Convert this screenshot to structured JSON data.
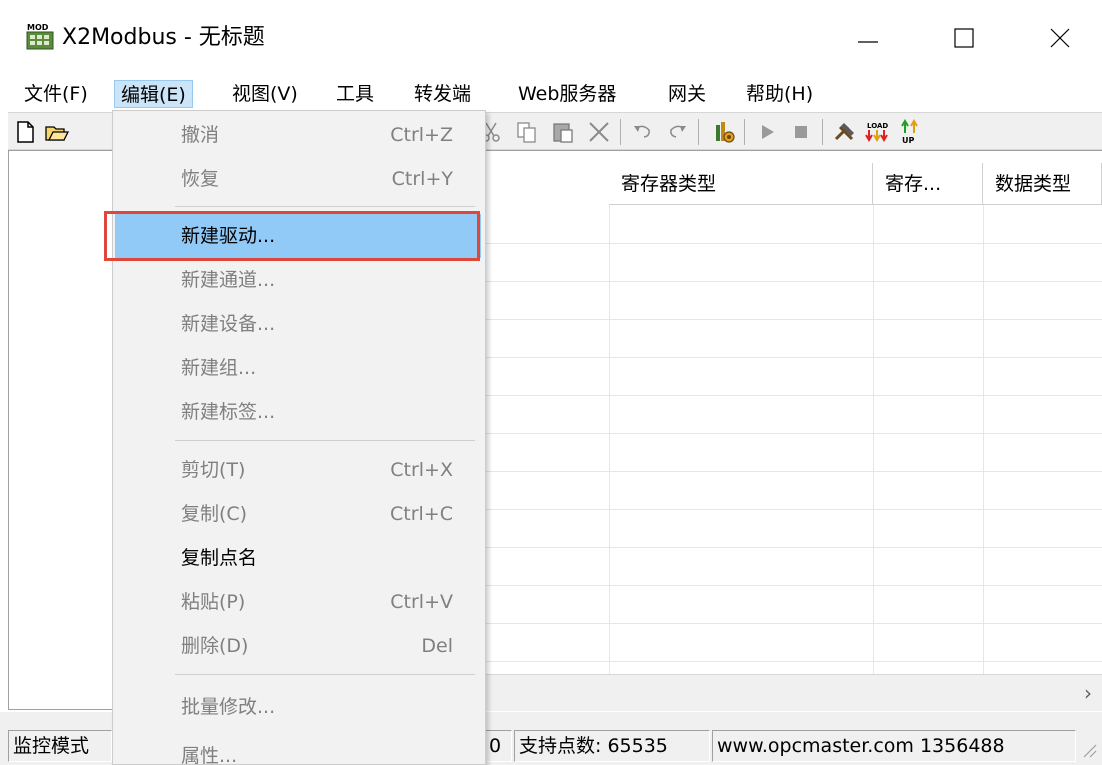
{
  "window": {
    "title": "X2Modbus - 无标题",
    "icon": "mod-app-icon",
    "controls": [
      "minimize-icon",
      "maximize-icon",
      "close-icon"
    ]
  },
  "menubar": {
    "items": [
      {
        "label": "文件(F)"
      },
      {
        "label": "编辑(E)"
      },
      {
        "label": "视图(V)"
      },
      {
        "label": "工具"
      },
      {
        "label": "转发端"
      },
      {
        "label": "Web服务器"
      },
      {
        "label": "网关"
      },
      {
        "label": "帮助(H)"
      }
    ]
  },
  "toolbar": {
    "icons": [
      "new-file-icon",
      "open-folder-icon",
      "cut-icon",
      "copy-icon",
      "paste-icon",
      "delete-icon",
      "undo-icon",
      "redo-icon",
      "driver-icon",
      "run-icon",
      "stop-icon",
      "tools-icon",
      "load-icon",
      "up-icon"
    ]
  },
  "grid": {
    "columns": [
      "寄存器类型",
      "寄存...",
      "数据类型"
    ]
  },
  "edit_menu": {
    "items": [
      {
        "label": "撤消",
        "shortcut": "Ctrl+Z",
        "enabled": false
      },
      {
        "label": "恢复",
        "shortcut": "Ctrl+Y",
        "enabled": false
      },
      {
        "label": "新建驱动...",
        "shortcut": "",
        "enabled": true,
        "highlighted": true
      },
      {
        "label": "新建通道...",
        "shortcut": "",
        "enabled": false
      },
      {
        "label": "新建设备...",
        "shortcut": "",
        "enabled": false
      },
      {
        "label": "新建组...",
        "shortcut": "",
        "enabled": false
      },
      {
        "label": "新建标签...",
        "shortcut": "",
        "enabled": false
      },
      {
        "label": "剪切(T)",
        "shortcut": "Ctrl+X",
        "enabled": false
      },
      {
        "label": "复制(C)",
        "shortcut": "Ctrl+C",
        "enabled": false
      },
      {
        "label": "复制点名",
        "shortcut": "",
        "enabled": true
      },
      {
        "label": "粘贴(P)",
        "shortcut": "Ctrl+V",
        "enabled": false
      },
      {
        "label": "删除(D)",
        "shortcut": "Del",
        "enabled": false
      },
      {
        "label": "批量修改...",
        "shortcut": "",
        "enabled": false
      },
      {
        "label": "属性...",
        "shortcut": "",
        "enabled": false
      }
    ]
  },
  "statusbar": {
    "mode": "监控模式",
    "count": "0",
    "capacity": "支持点数: 65535",
    "site": "www.opcmaster.com 1356488"
  },
  "colors": {
    "highlight": "#91c9f7",
    "highlight_border": "#e0473b",
    "menu_bg": "#f2f2f2",
    "disabled_text": "#808080"
  }
}
